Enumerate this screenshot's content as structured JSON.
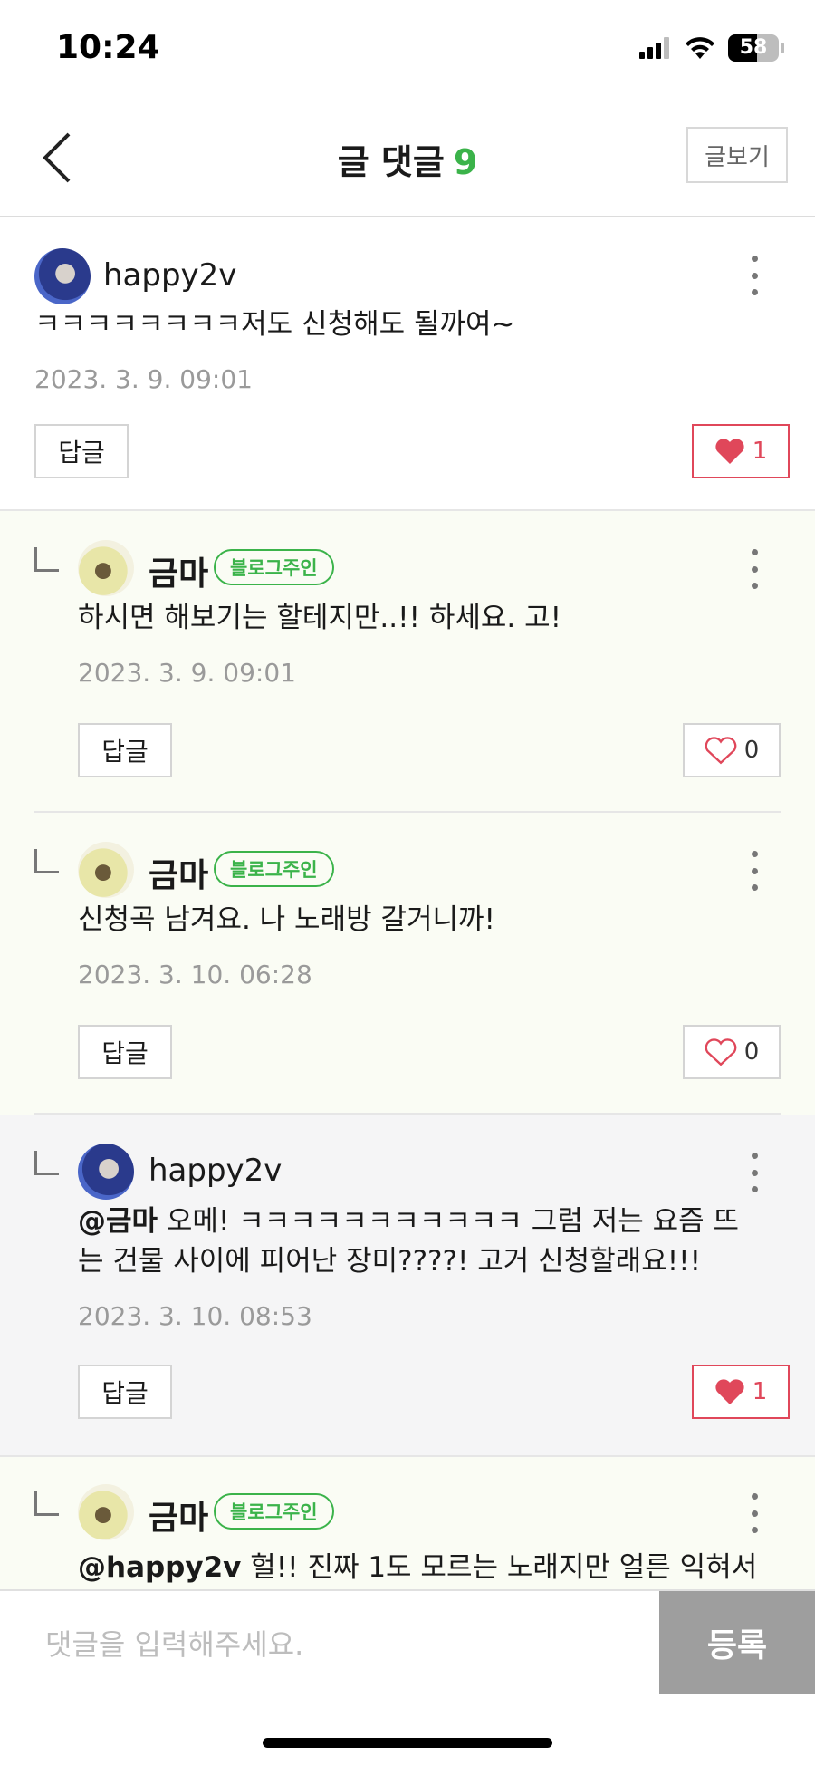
{
  "status_bar": {
    "time": "10:24",
    "battery": "58",
    "battery_level": 0.58
  },
  "header": {
    "title": "글 댓글",
    "count": "9",
    "view_post_label": "글보기"
  },
  "comments": [
    {
      "nickname": "happy2v",
      "text": "ㅋㅋㅋㅋㅋㅋㅋㅋ저도 신청해도 될까여~",
      "date": "2023. 3. 9. 09:01",
      "reply_label": "답글",
      "likes": "1",
      "liked": true
    },
    {
      "nickname": "금마",
      "badge": "블로그주인",
      "text": "하시면 해보기는 할테지만..!! 하세요. 고!",
      "date": "2023. 3. 9. 09:01",
      "reply_label": "답글",
      "likes": "0",
      "liked": false
    },
    {
      "nickname": "금마",
      "badge": "블로그주인",
      "text": "신청곡 남겨요. 나 노래방 갈거니까!",
      "date": "2023. 3. 10. 06:28",
      "reply_label": "답글",
      "likes": "0",
      "liked": false
    },
    {
      "nickname": "happy2v",
      "mention": "@금마",
      "text_line1": " 오메! ㅋㅋㅋㅋㅋㅋㅋㅋㅋㅋㅋ 그럼 저는 요즘 뜨",
      "text_line2": "는 건물 사이에 피어난 장미????! 고거 신청할래요!!!",
      "date": "2023. 3. 10. 08:53",
      "reply_label": "답글",
      "likes": "1",
      "liked": true
    },
    {
      "nickname": "금마",
      "badge": "블로그주인",
      "mention": "@happy2v",
      "text": " 헐!! 진짜 1도 모르는 노래지만 얼른 익혀서"
    }
  ],
  "input": {
    "placeholder": "댓글을 입력해주세요.",
    "submit_label": "등록"
  },
  "colors": {
    "accent_green": "#3bb34a",
    "like_red": "#e0475a"
  },
  "icons": [
    "signal-icon",
    "wifi-icon",
    "battery-icon",
    "back-chevron-icon",
    "more-vertical-icon",
    "heart-icon",
    "reply-arrow-icon"
  ]
}
